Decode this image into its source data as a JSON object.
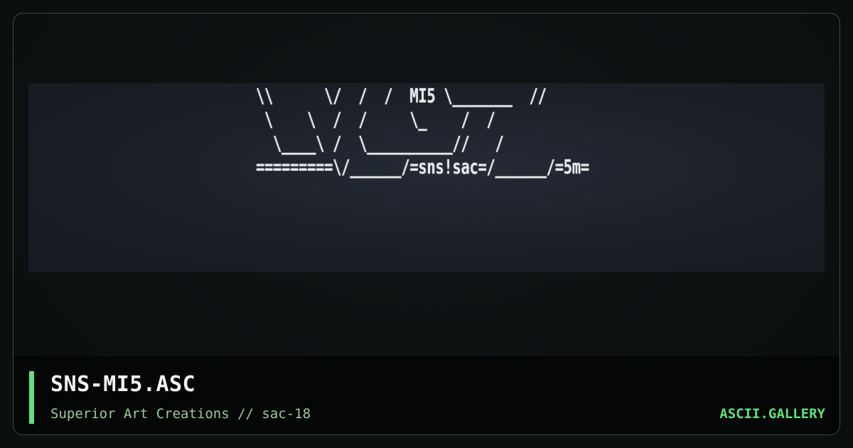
{
  "artwork": {
    "ascii_lines": [
      "\\\\      \\/  /  /  MI5 \\_______  //",
      " \\    \\  /  /     \\_    /  /",
      "  \\____\\ /  \\__________//   /",
      "=========\\/______/=sns!sac=/______/=5m="
    ]
  },
  "footer": {
    "title": "SNS-MI5.ASC",
    "subtitle": "Superior Art Creations // sac-18",
    "brand": "ASCII.GALLERY"
  },
  "colors": {
    "accent": "#5fe07a",
    "card_border": "#2c5a2f",
    "art_panel_bg": "#1c2129",
    "footer_bg": "#050606"
  }
}
